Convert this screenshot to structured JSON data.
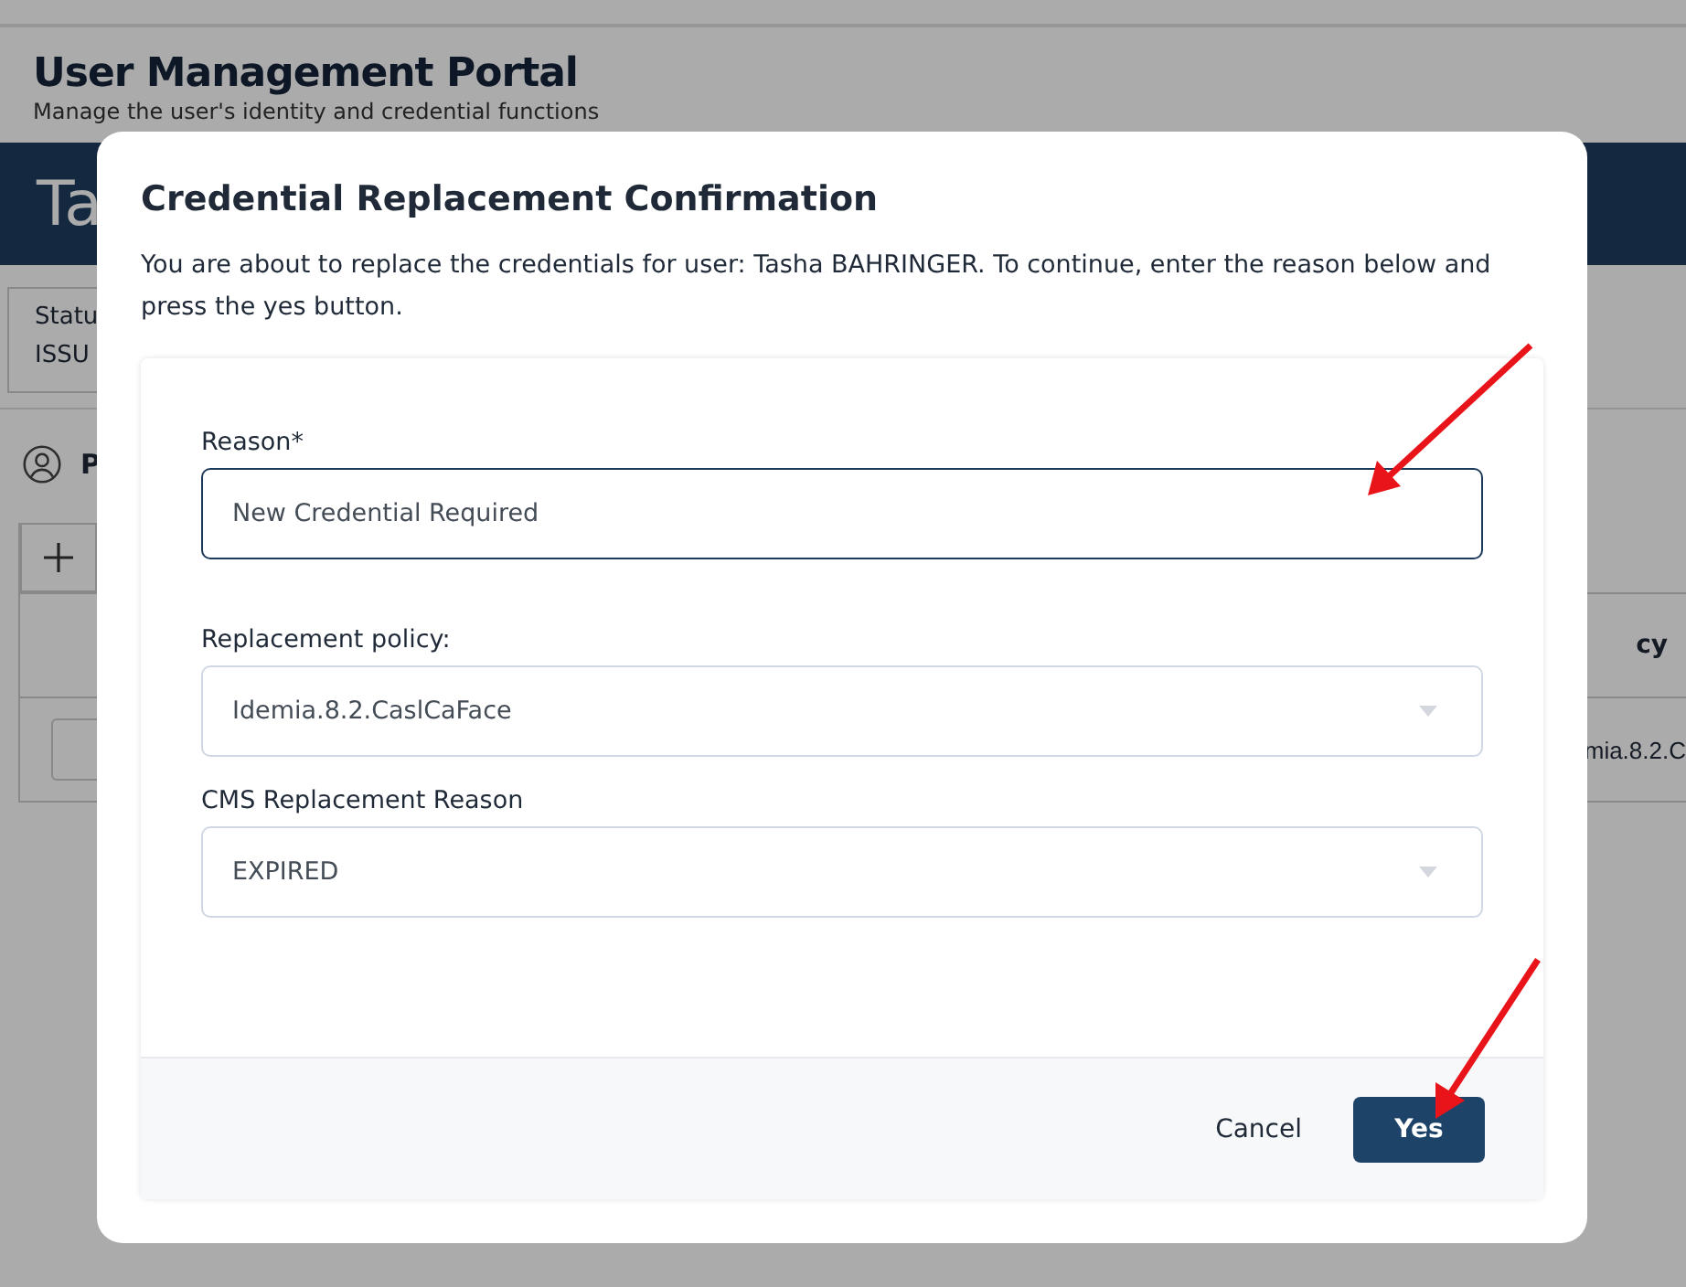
{
  "page": {
    "title": "User Management Portal",
    "subtitle": "Manage the user's identity and credential functions",
    "banner": "Ta",
    "status_label": "Statu",
    "status_value": "ISSU",
    "profile_label": "P",
    "table": {
      "column_header": "cy",
      "cell": "mia.8.2.C"
    }
  },
  "dialog": {
    "title": "Credential Replacement Confirmation",
    "message": "You are about to replace the credentials for user: Tasha BAHRINGER. To continue, enter the reason below and press the yes button.",
    "fields": [
      {
        "kind": "text",
        "label": "Reason*",
        "value": "New Credential Required"
      },
      {
        "kind": "select",
        "label": "Replacement policy:",
        "value": "Idemia.8.2.CaslCaFace"
      },
      {
        "kind": "select",
        "label": "CMS Replacement Reason",
        "value": "EXPIRED"
      }
    ],
    "buttons": [
      {
        "kind": "secondary",
        "label": "Cancel"
      },
      {
        "kind": "primary",
        "label": "Yes"
      }
    ]
  }
}
